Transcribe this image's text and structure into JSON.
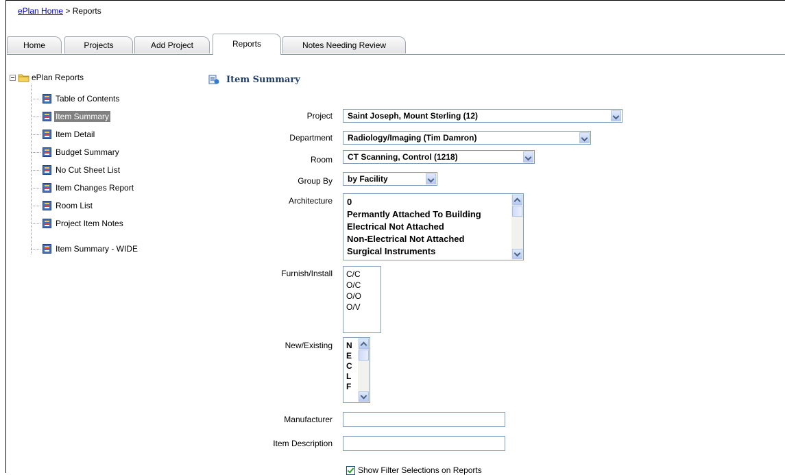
{
  "breadcrumb": {
    "home_link": "ePlan Home",
    "separator": ">",
    "current": "Reports"
  },
  "tabs": [
    {
      "label": "Home"
    },
    {
      "label": "Projects"
    },
    {
      "label": "Add Project"
    },
    {
      "label": "Reports",
      "active": true
    },
    {
      "label": "Notes Needing Review"
    }
  ],
  "tree": {
    "root_label": "ePlan Reports",
    "root_icon": "folder-icon",
    "item_icon": "report-icon",
    "selected": "Item Summary",
    "items": [
      {
        "label": "Table of Contents"
      },
      {
        "label": "Item Summary"
      },
      {
        "label": "Item Detail"
      },
      {
        "label": "Budget Summary"
      },
      {
        "label": "No Cut Sheet List"
      },
      {
        "label": "Item Changes Report"
      },
      {
        "label": "Room List"
      },
      {
        "label": "Project Item Notes"
      },
      {
        "label": "Item Summary - WIDE"
      }
    ]
  },
  "form": {
    "title": "Item Summary",
    "title_icon": "report-icon",
    "project": {
      "label": "Project",
      "value": "Saint Joseph, Mount Sterling (12)"
    },
    "department": {
      "label": "Department",
      "value": "Radiology/Imaging (Tim Damron)"
    },
    "room": {
      "label": "Room",
      "value": "CT Scanning, Control (1218)"
    },
    "group_by": {
      "label": "Group By",
      "value": "by Facility"
    },
    "architecture": {
      "label": "Architecture",
      "options": [
        "0",
        "Permantly Attached To Building",
        "Electrical Not Attached",
        "Non-Electrical Not Attached",
        "Surgical Instruments"
      ]
    },
    "furnish_install": {
      "label": "Furnish/Install",
      "options": [
        "C/C",
        "O/C",
        "O/O",
        "O/V"
      ]
    },
    "new_existing": {
      "label": "New/Existing",
      "options": [
        "N",
        "E",
        "C",
        "L",
        "F"
      ]
    },
    "manufacturer": {
      "label": "Manufacturer",
      "value": ""
    },
    "item_description": {
      "label": "Item Description",
      "value": ""
    },
    "show_filter": {
      "label": "Show Filter Selections on Reports",
      "checked": true
    }
  },
  "colors": {
    "link": "#0000cc",
    "selected_bg": "#808080",
    "title": "#1f3d6b",
    "input_border": "#7f9db9"
  }
}
